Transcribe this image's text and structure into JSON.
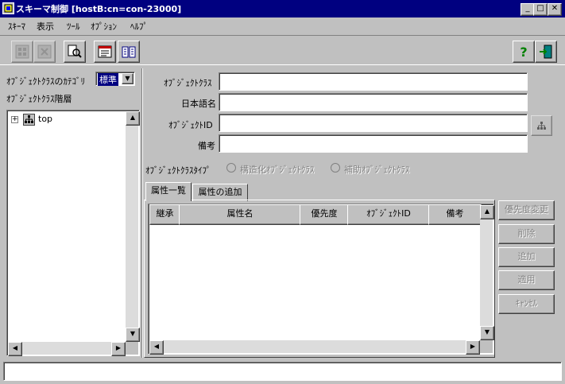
{
  "window": {
    "title": "スキーマ制御 [hostB:cn=con-23000]",
    "minimize": "_",
    "maximize": "□",
    "close": "✕"
  },
  "menu": {
    "items": [
      "ｽｷｰﾏ",
      "表示",
      "ﾂｰﾙ",
      "ｵﾌﾟｼｮﾝ",
      "ﾍﾙﾌﾟ"
    ]
  },
  "toolbar": {
    "help_label": "?"
  },
  "left_panel": {
    "category_label": "ｵﾌﾞｼﾞｪｸﾄｸﾗｽのｶﾃｺﾞﾘ",
    "category_value": "標準",
    "hierarchy_label": "ｵﾌﾞｼﾞｪｸﾄｸﾗｽ階層",
    "tree_expand": "+",
    "tree_root": "top"
  },
  "form": {
    "object_class_label": "ｵﾌﾞｼﾞｪｸﾄｸﾗｽ",
    "object_class_value": "",
    "japanese_name_label": "日本語名",
    "japanese_name_value": "",
    "object_id_label": "ｵﾌﾞｼﾞｪｸﾄID",
    "object_id_value": "",
    "remarks_label": "備考",
    "remarks_value": "",
    "type_label": "ｵﾌﾞｼﾞｪｸﾄｸﾗｽﾀｲﾌﾟ",
    "type_options": [
      "構造化ｵﾌﾞｼﾞｪｸﾄｸﾗｽ",
      "補助ｵﾌﾞｼﾞｪｸﾄｸﾗｽ"
    ]
  },
  "tabs": [
    "属性一覧",
    "属性の追加"
  ],
  "table": {
    "columns": [
      "継承",
      "属性名",
      "優先度",
      "ｵﾌﾞｼﾞｪｸﾄID",
      "備考"
    ],
    "rows": []
  },
  "side_buttons": {
    "priority_change": "優先度変更",
    "delete": "削除",
    "add": "追加",
    "apply": "適用",
    "cancel": "ｷｬﾝｾﾙ"
  },
  "status_bar": {
    "text": ""
  },
  "colors": {
    "title_bar": "#000080",
    "face": "#c0c0c0",
    "selection": "#000080"
  }
}
